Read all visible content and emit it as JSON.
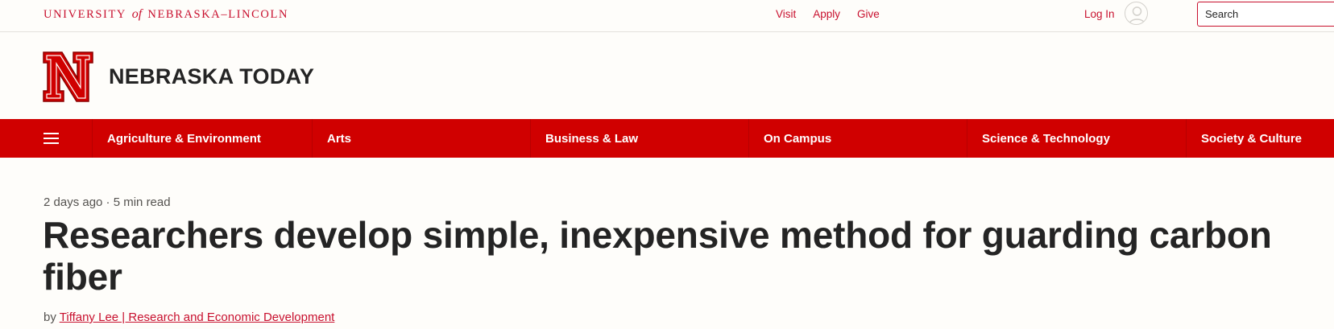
{
  "topbar": {
    "wordmark_pre": "UNIVERSITY",
    "wordmark_of": "of",
    "wordmark_post": "NEBRASKA–LINCOLN",
    "links": [
      "Visit",
      "Apply",
      "Give"
    ],
    "login_label": "Log In",
    "search_placeholder": "Search"
  },
  "header": {
    "logo_icon": "n-logo-icon",
    "site_title": "NEBRASKA TODAY"
  },
  "nav": {
    "menu_icon": "hamburger-icon",
    "items": [
      "Agriculture & Environment",
      "Arts",
      "Business & Law",
      "On Campus",
      "Science & Technology",
      "Society & Culture"
    ]
  },
  "article": {
    "meta": "2 days ago · 5 min read",
    "headline": "Researchers develop simple, inexpensive method for guarding carbon fiber",
    "byline_prefix": "by",
    "author_link": "Tiffany Lee | Research and Economic Development"
  },
  "colors": {
    "brand_red": "#d00000",
    "text_red": "#c8102e",
    "background": "#fefdfa",
    "text": "#242424"
  }
}
